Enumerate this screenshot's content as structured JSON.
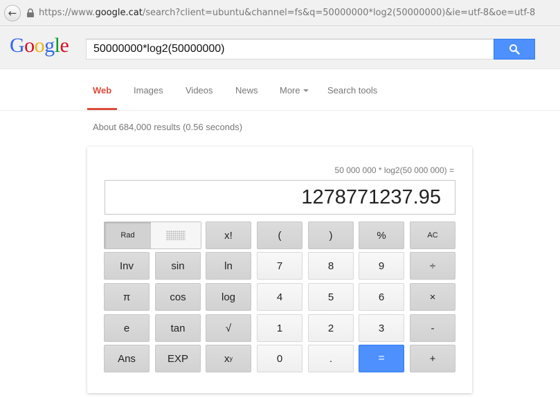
{
  "browser": {
    "url_prefix": "https://www.",
    "url_host": "google.cat",
    "url_rest": "/search?client=ubuntu&channel=fs&q=50000000*log2(50000000)&ie=utf-8&oe=utf-8"
  },
  "google": {
    "logo_letters": [
      "G",
      "o",
      "o",
      "g",
      "l",
      "e"
    ],
    "logo_colors": [
      "#3369e8",
      "#d50f25",
      "#eeb211",
      "#3369e8",
      "#009925",
      "#d50f25"
    ],
    "query": "50000000*log2(50000000)"
  },
  "tabs": [
    {
      "label": "Web",
      "active": true
    },
    {
      "label": "Images"
    },
    {
      "label": "Videos"
    },
    {
      "label": "News"
    },
    {
      "label": "More"
    },
    {
      "label": "Search tools"
    }
  ],
  "results_count": "About 684,000 results (0.56 seconds)",
  "calculator": {
    "expression": "50 000 000 * log2(50 000 000) =",
    "result": "1278771237.95",
    "mode_label": "Rad",
    "keys": {
      "fact": "x!",
      "lparen": "(",
      "rparen": ")",
      "percent": "%",
      "ac": "AC",
      "inv": "Inv",
      "sin": "sin",
      "ln": "ln",
      "k7": "7",
      "k8": "8",
      "k9": "9",
      "divide": "÷",
      "pi": "π",
      "cos": "cos",
      "log": "log",
      "k4": "4",
      "k5": "5",
      "k6": "6",
      "multiply": "×",
      "e": "e",
      "tan": "tan",
      "sqrt": "√",
      "k1": "1",
      "k2": "2",
      "k3": "3",
      "minus": "-",
      "ans": "Ans",
      "exp": "EXP",
      "pow_base": "x",
      "pow_exp": "y",
      "k0": "0",
      "dot": ".",
      "equals": "=",
      "plus": "+"
    }
  }
}
